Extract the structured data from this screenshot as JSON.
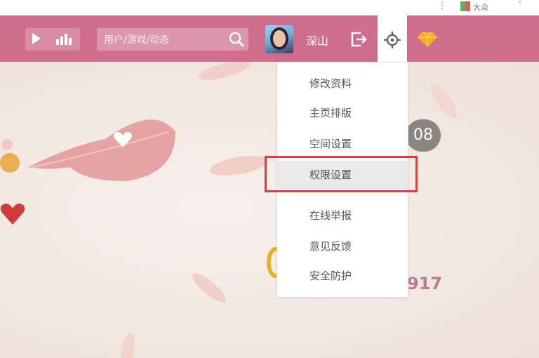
{
  "browser": {
    "dots": "⋮",
    "extension_label": "大众",
    "caret": "ˇ"
  },
  "navbar": {
    "search_placeholder": "用户/游戏/动态",
    "username": "深山"
  },
  "settings_menu": {
    "items": [
      "修改资料",
      "主页排版",
      "空间设置",
      "权限设置",
      "在线举报",
      "意见反馈",
      "安全防护"
    ],
    "selected": "权限设置"
  },
  "background": {
    "badge_text": "08",
    "count_text": "917"
  },
  "colors": {
    "navbar": "#cf6d8c",
    "highlight": "#e23b3b",
    "badge": "#8a8580",
    "gold": "#e3b22b"
  },
  "icons": [
    "play-icon",
    "stats-bars-icon",
    "search-icon",
    "logout-icon",
    "gear-icon",
    "diamond-icon",
    "heart-icon"
  ]
}
